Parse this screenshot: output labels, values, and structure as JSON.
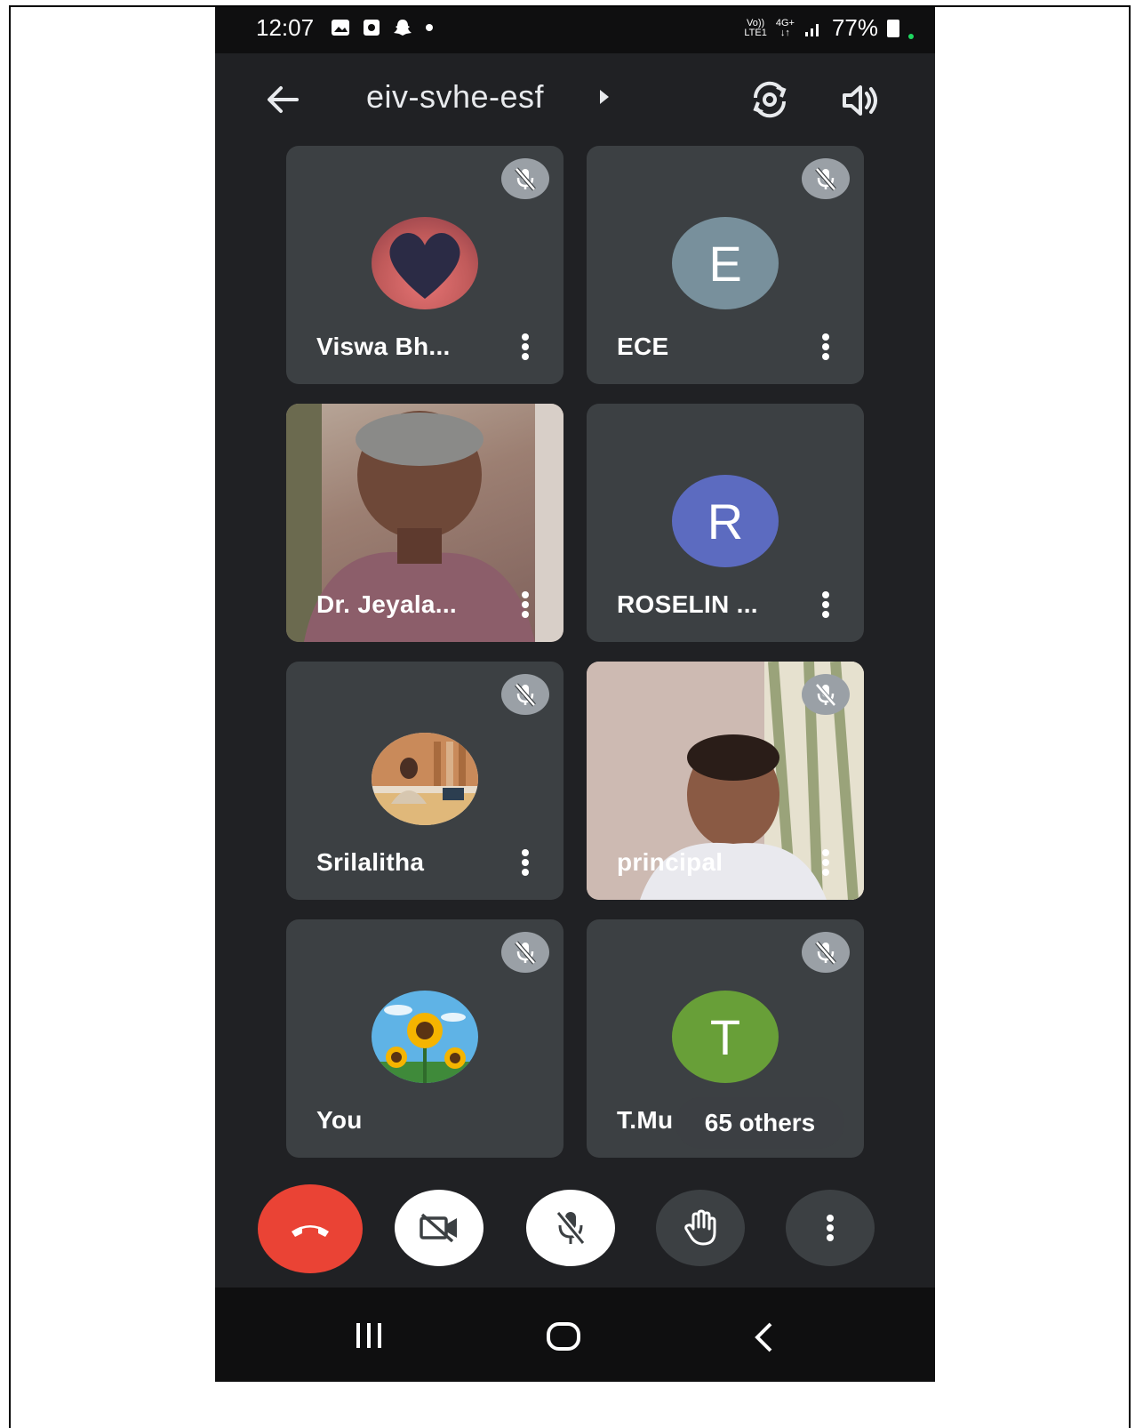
{
  "status_bar": {
    "time": "12:07",
    "network_line1": "Vo))",
    "network_line2": "LTE1",
    "network_gen": "4G+",
    "battery": "77%"
  },
  "header": {
    "title": "eiv-svhe-esf"
  },
  "participants": [
    {
      "name": "Viswa Bh...",
      "avatar_type": "photo-heart",
      "muted": true
    },
    {
      "name": "ECE",
      "avatar_type": "letter",
      "letter": "E",
      "color": "#78909c",
      "muted": true
    },
    {
      "name": "Dr. Jeyala...",
      "avatar_type": "video",
      "muted": false
    },
    {
      "name": "ROSELIN ...",
      "avatar_type": "letter",
      "letter": "R",
      "color": "#5c6bc0",
      "muted": false
    },
    {
      "name": "Srilalitha",
      "avatar_type": "photo-office",
      "muted": true
    },
    {
      "name": "principal",
      "avatar_type": "video",
      "muted": true
    },
    {
      "name": "You",
      "avatar_type": "photo-sunflower",
      "muted": true
    },
    {
      "name": "T.Mu",
      "avatar_type": "letter",
      "letter": "T",
      "color": "#689f38",
      "muted": true
    }
  ],
  "others_chip": "65 others",
  "colors": {
    "background": "#202124",
    "tile": "#3c4043",
    "end_call": "#ea4335"
  }
}
